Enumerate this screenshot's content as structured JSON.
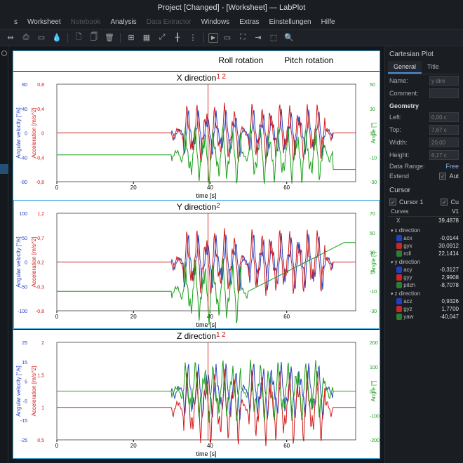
{
  "window": {
    "title": "Project [Changed] - [Worksheet] — LabPlot"
  },
  "menu": {
    "items": [
      "s",
      "Worksheet",
      "Notebook",
      "Analysis",
      "Data Extractor",
      "Windows",
      "Extras",
      "Einstellungen",
      "Hilfe"
    ],
    "disabled": [
      2,
      4
    ]
  },
  "toolbar": {
    "icons": [
      "pointer-icon",
      "save-icon",
      "blank",
      "droplet-icon",
      "sep",
      "new-doc-icon",
      "duplicate-icon",
      "delete-icon",
      "sep",
      "add-panel-icon",
      "grid-icon",
      "resize-icon",
      "axes-icon",
      "scatter-icon",
      "sep",
      "play-icon",
      "rect-icon",
      "fit-icon",
      "goto-icon",
      "pagefit-icon",
      "zoom-icon"
    ]
  },
  "worksheet": {
    "header": {
      "roll": "Roll rotation",
      "pitch": "Pitch rotation"
    },
    "plots": [
      {
        "title": "X direction",
        "markers": [
          "1",
          "2"
        ]
      },
      {
        "title": "Y direction",
        "markers": [
          "2"
        ],
        "selected": true
      },
      {
        "title": "Z direction",
        "markers": [
          "1",
          "2"
        ]
      }
    ],
    "xaxis": {
      "label": "time [s]",
      "ticks": [
        0,
        20,
        40,
        60
      ]
    },
    "leftAxis1": {
      "label": "Angular velocity [°/s]",
      "color": "#2040c0"
    },
    "leftAxis2": {
      "label": "Acceleration [m/s^2]",
      "color": "#d01818"
    },
    "rightAxis": {
      "label": "Angle [°]",
      "color": "#18a018"
    }
  },
  "chart_data": [
    {
      "type": "line",
      "title": "X direction",
      "xlabel": "time [s]",
      "xlim": [
        0,
        78
      ],
      "series": [
        {
          "name": "Angular velocity [°/s]",
          "color": "#2040c0",
          "ylim": [
            -80,
            80
          ],
          "ticks": [
            -80,
            -40,
            0,
            40,
            80
          ]
        },
        {
          "name": "Acceleration [m/s^2]",
          "color": "#d01818",
          "ylim": [
            -0.8,
            0.8
          ],
          "ticks": [
            -0.8,
            -0.4,
            0.0,
            0.4,
            0.8
          ]
        },
        {
          "name": "Angle [°]",
          "color": "#18a018",
          "ylim": [
            -30,
            50
          ],
          "ticks": [
            -30,
            -10,
            10,
            30,
            50
          ]
        }
      ],
      "note": "Signals near zero until t≈30s, then oscillations ~±40 (blue) / ~±0.5 (red) over 33–48s (roll) and 50–70s (pitch); green angle drifts to ~-20 at t>73s."
    },
    {
      "type": "line",
      "title": "Y direction",
      "xlabel": "time [s]",
      "xlim": [
        0,
        78
      ],
      "series": [
        {
          "name": "Angular velocity [°/s]",
          "color": "#2040c0",
          "ylim": [
            -100,
            100
          ],
          "ticks": [
            -100,
            -50,
            0,
            50,
            100
          ]
        },
        {
          "name": "Acceleration [m/s^2]",
          "color": "#d01818",
          "ylim": [
            -0.8,
            1.2
          ],
          "ticks": [
            -0.8,
            -0.3,
            0.2,
            0.7,
            1.2
          ]
        },
        {
          "name": "Angle [°]",
          "color": "#18a018",
          "ylim": [
            -30,
            70
          ],
          "ticks": [
            -30,
            -10,
            10,
            30,
            50,
            70
          ]
        }
      ],
      "note": "Red baseline ~0.2 with burst to ~1.0 at 50–72s; blue bursts ±60 in same intervals; green rises from ~-10 to ~40 during pitch segment."
    },
    {
      "type": "line",
      "title": "Z direction",
      "xlabel": "time [s]",
      "xlim": [
        0,
        78
      ],
      "series": [
        {
          "name": "Angular velocity [°/s]",
          "color": "#2040c0",
          "ylim": [
            -25,
            25
          ],
          "ticks": [
            -25,
            -15,
            -5,
            5,
            15,
            25
          ]
        },
        {
          "name": "Acceleration [m/s^2]",
          "color": "#d01818",
          "ylim": [
            0.5,
            2.0
          ],
          "ticks": [
            0.5,
            1.0,
            1.5,
            2.0
          ]
        },
        {
          "name": "Angle [°]",
          "color": "#18a018",
          "ylim": [
            -200,
            200
          ],
          "ticks": [
            -200,
            -100,
            0,
            100,
            200
          ]
        }
      ],
      "note": "Red baseline ~1.0 with noisy excursions 0.6–1.8 after 30s; blue baseline 0 with ±15 noise after 30s; green near 0 then oscillates ±150 after 60s."
    }
  ],
  "cartesian": {
    "title": "Cartesian Plot",
    "tabs": {
      "active": "General",
      "other": "Title"
    },
    "name_label": "Name:",
    "name_value": "y dire",
    "comment_label": "Comment:",
    "geometry_label": "Geometry",
    "left_label": "Left:",
    "left_value": "0,00 c",
    "top_label": "Top:",
    "top_value": "7,67 c",
    "width_label": "Width:",
    "width_value": "20,00",
    "height_label": "Height:",
    "height_value": "6,17 c",
    "datarange_label": "Data Range:",
    "datarange_value": "Free",
    "extend_label": "Extend",
    "extend_cb": "Aut"
  },
  "cursor": {
    "title": "Cursor",
    "c1_label": "Cursor 1",
    "c2_label": "Cu",
    "curves_h": "Curves",
    "v1_h": "V1",
    "x_label": "X",
    "x_val": "39,4878",
    "groups": [
      {
        "name": "x direction",
        "rows": [
          {
            "k": "acx",
            "v": "-0,0144",
            "c": "#2040c0"
          },
          {
            "k": "gyx",
            "v": "30,0912",
            "c": "#c62828"
          },
          {
            "k": "roll",
            "v": "22,1414",
            "c": "#2e7d32"
          }
        ]
      },
      {
        "name": "y direction",
        "rows": [
          {
            "k": "acy",
            "v": "-0,3127",
            "c": "#2040c0"
          },
          {
            "k": "gyy",
            "v": "2,9908",
            "c": "#c62828"
          },
          {
            "k": "pitch",
            "v": "-8,7078",
            "c": "#2e7d32"
          }
        ]
      },
      {
        "name": "z direction",
        "rows": [
          {
            "k": "acz",
            "v": "0,9326",
            "c": "#2040c0"
          },
          {
            "k": "gyz",
            "v": "1,7700",
            "c": "#c62828"
          },
          {
            "k": "yaw",
            "v": "-40,047",
            "c": "#2e7d32"
          }
        ]
      }
    ]
  }
}
